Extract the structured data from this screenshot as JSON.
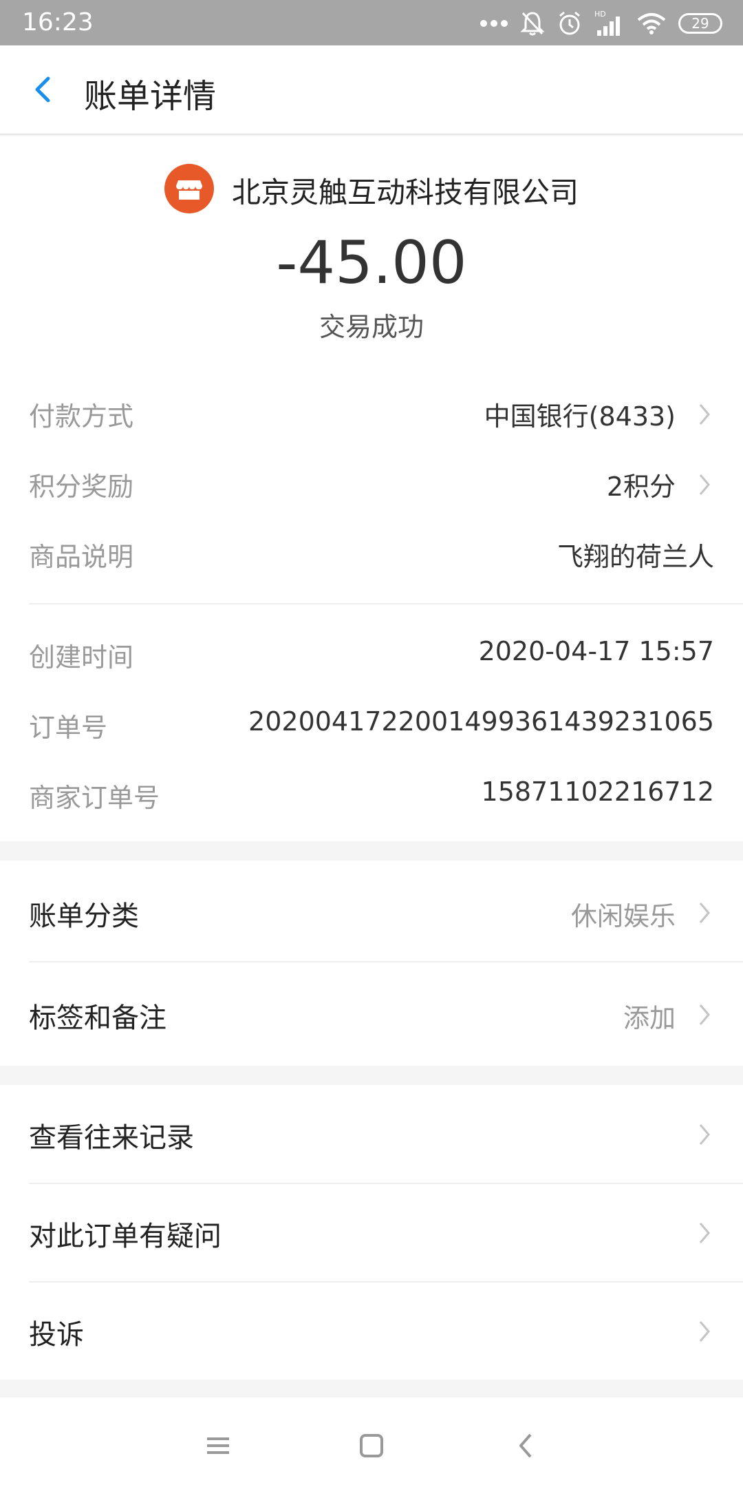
{
  "status_bar": {
    "time": "16:23",
    "signal_label": "HD",
    "battery": "29",
    "icons": [
      "more-dots-icon",
      "mute-bell-icon",
      "alarm-icon",
      "signal-icon",
      "wifi-icon",
      "battery-icon"
    ]
  },
  "header": {
    "title": "账单详情",
    "back_icon": "chevron-left-icon"
  },
  "summary": {
    "merchant_name": "北京灵触互动科技有限公司",
    "merchant_icon": "shop-icon",
    "amount": "-45.00",
    "status": "交易成功"
  },
  "details_1": [
    {
      "label": "付款方式",
      "value": "中国银行(8433)",
      "has_arrow": true
    },
    {
      "label": "积分奖励",
      "value": "2积分",
      "has_arrow": true
    },
    {
      "label": "商品说明",
      "value": "飞翔的荷兰人",
      "has_arrow": false
    }
  ],
  "details_2": [
    {
      "label": "创建时间",
      "value": "2020-04-17 15:57"
    },
    {
      "label": "订单号",
      "value": "2020041722001499361439231065"
    },
    {
      "label": "商家订单号",
      "value": "15871102216712"
    }
  ],
  "category_section": [
    {
      "label": "账单分类",
      "value": "休闲娱乐"
    },
    {
      "label": "标签和备注",
      "value": "添加"
    }
  ],
  "actions": [
    {
      "label": "查看往来记录"
    },
    {
      "label": "对此订单有疑问"
    },
    {
      "label": "投诉"
    }
  ],
  "colors": {
    "accent_blue": "#1a8ef0",
    "merchant_orange": "#e8592a",
    "status_bar": "#a6a6a6"
  },
  "nav_bar": {
    "icons": [
      "menu-icon",
      "home-square-icon",
      "back-triangle-icon"
    ]
  }
}
